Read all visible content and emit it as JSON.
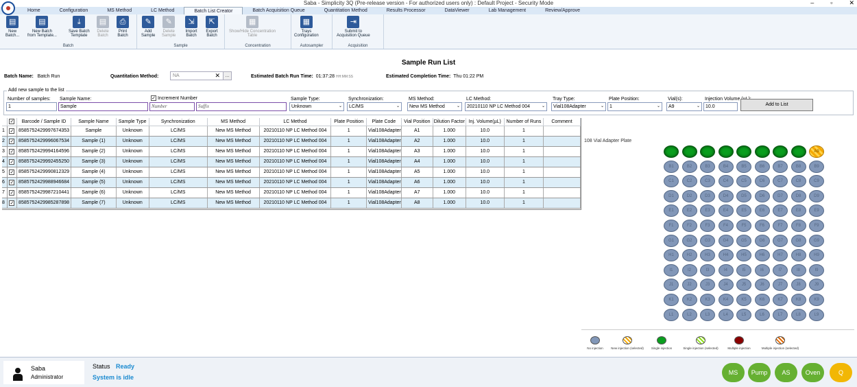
{
  "window": {
    "title": "Saba - Simplicity 3Q (Pre-release version - For authorized users only) : Default Project - Security Mode",
    "minimize": "–",
    "maximize": "▫",
    "close": "✕"
  },
  "menu": [
    "Home",
    "Configuration",
    "MS Method",
    "LC Method",
    "Batch List Creator",
    "Batch Acquisition Queue",
    "Quantitation Method",
    "Results Processor",
    "DataViewer",
    "Lab Management",
    "Review/Approve"
  ],
  "menu_active": "Batch List Creator",
  "ribbon": {
    "groups": [
      {
        "label": "Batch",
        "buttons": [
          {
            "label1": "New",
            "label2": "Batch...",
            "icon": "new-batch-icon",
            "glyph": "▤",
            "enabled": true
          },
          {
            "label1": "New Batch",
            "label2": "from Template...",
            "icon": "new-batch-template-icon",
            "glyph": "▤",
            "enabled": true
          },
          {
            "label1": "Save Batch",
            "label2": "Template",
            "icon": "save-template-icon",
            "glyph": "⤓",
            "enabled": true
          },
          {
            "label1": "Delete",
            "label2": "Batch",
            "icon": "delete-batch-icon",
            "glyph": "▤",
            "enabled": false
          },
          {
            "label1": "Print",
            "label2": "Batch",
            "icon": "print-icon",
            "glyph": "⎙",
            "enabled": true
          }
        ]
      },
      {
        "label": "Sample",
        "buttons": [
          {
            "label1": "Add",
            "label2": "Sample",
            "icon": "add-sample-icon",
            "glyph": "✎",
            "enabled": true
          },
          {
            "label1": "Delete",
            "label2": "Sample",
            "icon": "delete-sample-icon",
            "glyph": "✎",
            "enabled": false
          },
          {
            "label1": "Import",
            "label2": "Batch",
            "icon": "import-batch-icon",
            "glyph": "⇲",
            "enabled": true
          },
          {
            "label1": "Export",
            "label2": "Batch",
            "icon": "export-batch-icon",
            "glyph": "⇱",
            "enabled": true
          }
        ]
      },
      {
        "label": "Concentration",
        "buttons": [
          {
            "label1": "Show/Hide Concentration",
            "label2": "Table",
            "icon": "concentration-table-icon",
            "glyph": "▦",
            "enabled": false
          }
        ]
      },
      {
        "label": "Autosampler",
        "buttons": [
          {
            "label1": "Trays",
            "label2": "Configuration",
            "icon": "trays-configuration-icon",
            "glyph": "▦",
            "enabled": true
          }
        ]
      },
      {
        "label": "Acquisition",
        "buttons": [
          {
            "label1": "Submit to",
            "label2": "Acquisition Queue",
            "icon": "submit-queue-icon",
            "glyph": "⇥",
            "enabled": true
          }
        ]
      }
    ]
  },
  "page_title": "Sample Run List",
  "header": {
    "batch_name_label": "Batch Name:",
    "batch_name": "Batch Run",
    "quant_label": "Quantitation Method:",
    "quant_value": "NA",
    "quant_clear": "✕",
    "quant_browse": "...",
    "run_time_label": "Estimated Batch Run Time:",
    "run_time": "01:37:28",
    "run_time_unit": "HH:MM:SS",
    "completion_label": "Estimated Completion Time:",
    "completion": "Thu 01:22 PM"
  },
  "add_sample": {
    "legend": "Add new sample to the list",
    "num_samples_label": "Number of samples:",
    "num_samples": "1",
    "sample_name_label": "Sample Name:",
    "sample_name": "Sample",
    "increment_label": "Increment Number",
    "increment_check": "✓",
    "number_placeholder": "Number",
    "suffix_placeholder": "Suffix",
    "sample_type_label": "Sample Type:",
    "sample_type": "Unknown",
    "sync_label": "Synchronization:",
    "sync": "LC/MS",
    "ms_label": "MS Method:",
    "ms": "New MS Method",
    "lc_label": "LC Method:",
    "lc": "20210110 NP LC Method 004",
    "tray_label": "Tray Type:",
    "tray": "Vial108Adapter",
    "plate_label": "Plate Position:",
    "plate": "1",
    "vial_label": "Vial(s):",
    "vial": "A9",
    "inj_label": "Injection Volume (µL):",
    "inj": "10.0",
    "add_button": "Add to List",
    "dropdown_arrow": "⌄"
  },
  "table": {
    "headers": [
      "Barcode / Sample ID",
      "Sample Name",
      "Sample Type",
      "Synchronization",
      "MS Method",
      "LC Method",
      "Plate Position",
      "Plate Code",
      "Vial Position",
      "Dilution Factor",
      "Inj. Volume(µL)",
      "Number of Runs",
      "Comment"
    ],
    "check_mark": "✓",
    "rows": [
      {
        "n": "1",
        "cells": [
          "8585752429997674353",
          "Sample",
          "Unknown",
          "LC/MS",
          "New MS Method",
          "20210110 NP LC Method 004",
          "1",
          "Vial108Adapter",
          "A1",
          "1.000",
          "10.0",
          "1",
          ""
        ]
      },
      {
        "n": "2",
        "cells": [
          "8585752429996067534",
          "Sample (1)",
          "Unknown",
          "LC/MS",
          "New MS Method",
          "20210110 NP LC Method 004",
          "1",
          "Vial108Adapter",
          "A2",
          "1.000",
          "10.0",
          "1",
          ""
        ]
      },
      {
        "n": "3",
        "cells": [
          "8585752429994164596",
          "Sample (2)",
          "Unknown",
          "LC/MS",
          "New MS Method",
          "20210110 NP LC Method 004",
          "1",
          "Vial108Adapter",
          "A3",
          "1.000",
          "10.0",
          "1",
          ""
        ]
      },
      {
        "n": "4",
        "cells": [
          "8585752429992455250",
          "Sample (3)",
          "Unknown",
          "LC/MS",
          "New MS Method",
          "20210110 NP LC Method 004",
          "1",
          "Vial108Adapter",
          "A4",
          "1.000",
          "10.0",
          "1",
          ""
        ]
      },
      {
        "n": "5",
        "cells": [
          "8585752429990812329",
          "Sample (4)",
          "Unknown",
          "LC/MS",
          "New MS Method",
          "20210110 NP LC Method 004",
          "1",
          "Vial108Adapter",
          "A5",
          "1.000",
          "10.0",
          "1",
          ""
        ]
      },
      {
        "n": "6",
        "cells": [
          "8585752429988946684",
          "Sample (5)",
          "Unknown",
          "LC/MS",
          "New MS Method",
          "20210110 NP LC Method 004",
          "1",
          "Vial108Adapter",
          "A6",
          "1.000",
          "10.0",
          "1",
          ""
        ]
      },
      {
        "n": "7",
        "cells": [
          "8585752429987210441",
          "Sample (6)",
          "Unknown",
          "LC/MS",
          "New MS Method",
          "20210110 NP LC Method 004",
          "1",
          "Vial108Adapter",
          "A7",
          "1.000",
          "10.0",
          "1",
          ""
        ]
      },
      {
        "n": "8",
        "cells": [
          "8585752429985287898",
          "Sample (7)",
          "Unknown",
          "LC/MS",
          "New MS Method",
          "20210110 NP LC Method 004",
          "1",
          "Vial108Adapter",
          "A8",
          "1.000",
          "10.0",
          "1",
          ""
        ]
      }
    ]
  },
  "plate": {
    "title": "108 Vial Adapter Plate",
    "rows": [
      "A",
      "B",
      "C",
      "D",
      "E",
      "F",
      "G",
      "H",
      "I",
      "J",
      "K",
      "L"
    ],
    "cols": 9,
    "single_injection_vials": [
      "A1",
      "A2",
      "A3",
      "A4",
      "A5",
      "A6",
      "A7",
      "A8"
    ],
    "selected_vial": "A9",
    "legend": [
      "No injection",
      "New injection (selected)",
      "Single injection",
      "Single injection (selected)",
      "Multiple injection",
      "Multiple injection (selected)"
    ]
  },
  "colors": {
    "no_injection": "#8297b8",
    "new_selected": "#f5a800",
    "single": "#0a9e1e",
    "single_selected": "#8fe01a",
    "multiple": "#8a0000",
    "multiple_selected": "#e46a00"
  },
  "status": {
    "user": "Saba",
    "role": "Administrator",
    "status_label": "Status",
    "status_value": "Ready",
    "idle": "System is idle",
    "modules": [
      "MS",
      "Pump",
      "AS",
      "Oven",
      "Q"
    ]
  }
}
